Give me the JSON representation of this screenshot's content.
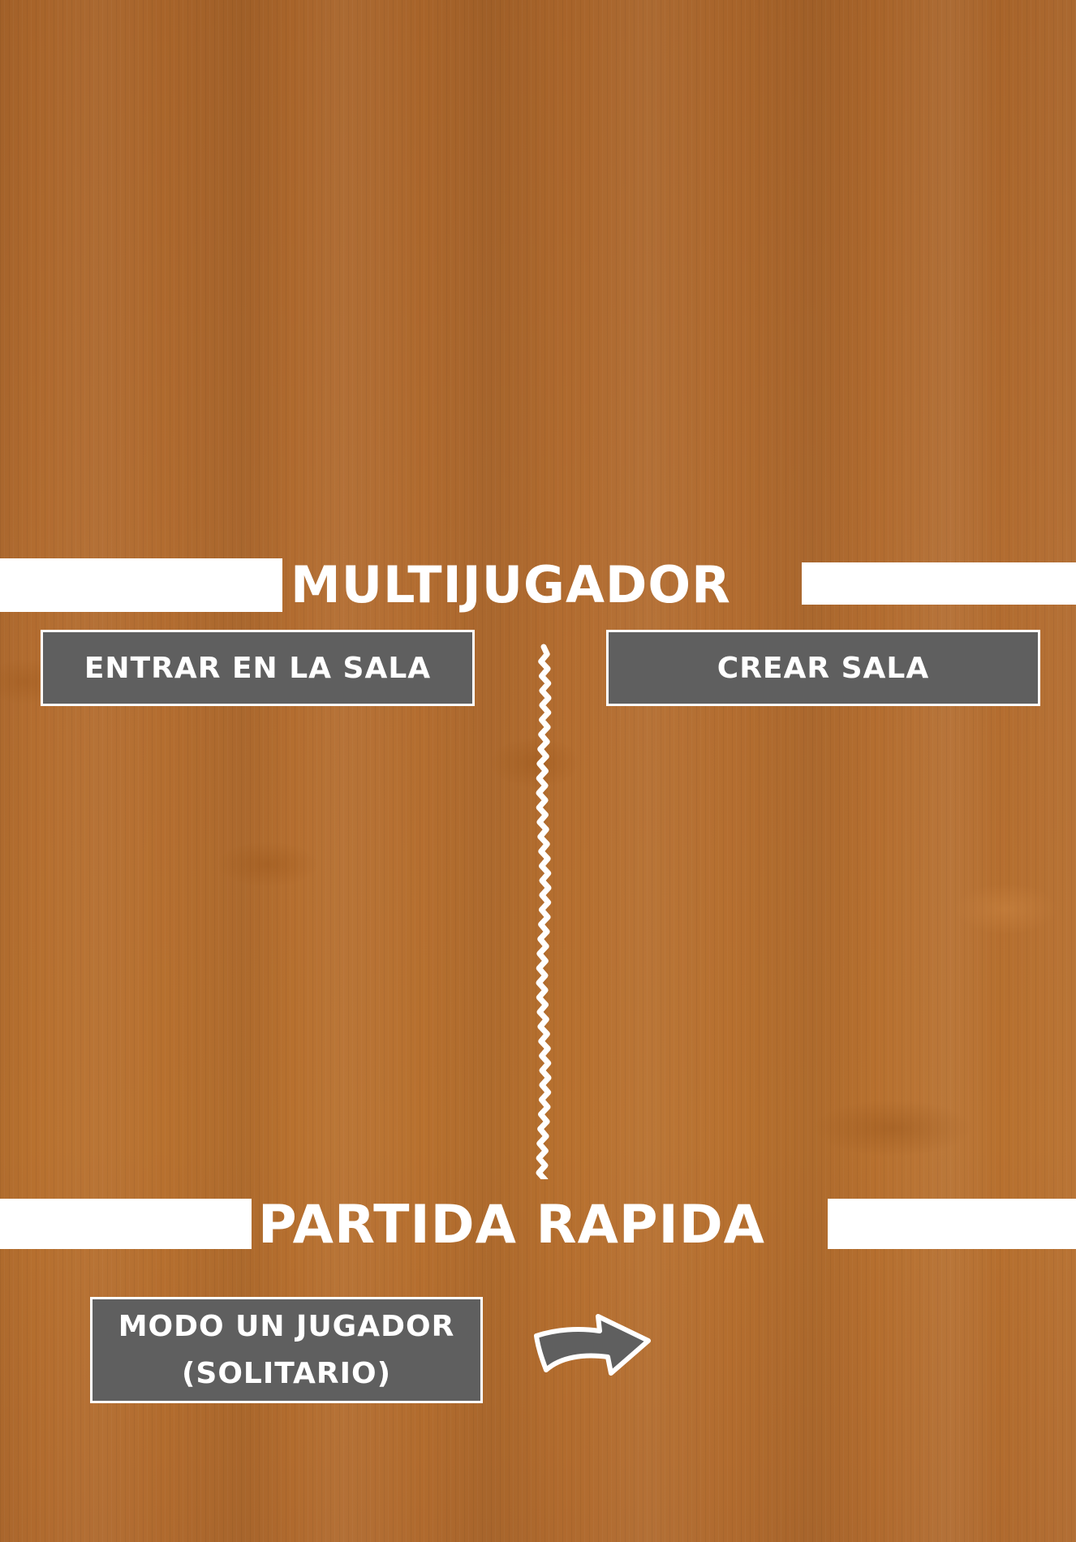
{
  "multijugador": {
    "title": "MULTIJUGADOR",
    "join_room_label": "ENTRAR EN LA SALA",
    "create_room_label": "CREAR SALA"
  },
  "partida_rapida": {
    "title": "PARTIDA RAPIDA",
    "single_player_label_line1": "MODO UN JUGADOR",
    "single_player_label_line2": "(SOLITARIO)"
  },
  "icons": {
    "divider": "chalk-divider-line",
    "arrow": "right-arrow-icon"
  },
  "colors": {
    "background_wood": "#b06a2e",
    "band": "#ffffff",
    "button_fill": "#5f5f5f",
    "button_border": "#ffffff",
    "text": "#ffffff"
  }
}
